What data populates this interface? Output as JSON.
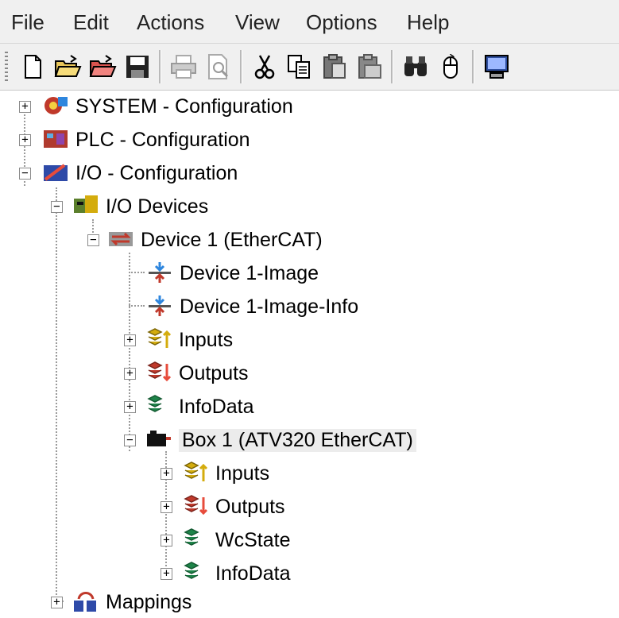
{
  "menubar": {
    "items": [
      "File",
      "Edit",
      "Actions",
      "View",
      "Options",
      "Help"
    ]
  },
  "toolbar": {
    "buttons": [
      "new-icon",
      "open-icon",
      "open-project-icon",
      "save-icon",
      "print-icon",
      "print-preview-icon",
      "cut-icon",
      "copy-icon",
      "paste-icon",
      "paste-special-icon",
      "find-icon",
      "mouse-icon",
      "monitor-icon"
    ]
  },
  "tree": {
    "system": "SYSTEM - Configuration",
    "plc": "PLC - Configuration",
    "io": "I/O - Configuration",
    "io_devices": "I/O Devices",
    "device1": "Device 1 (EtherCAT)",
    "device1_image": "Device 1-Image",
    "device1_image_info": "Device 1-Image-Info",
    "inputs": "Inputs",
    "outputs": "Outputs",
    "infodata": "InfoData",
    "box1": "Box 1 (ATV320 EtherCAT)",
    "box_inputs": "Inputs",
    "box_outputs": "Outputs",
    "box_wcstate": "WcState",
    "box_infodata": "InfoData",
    "mappings": "Mappings"
  }
}
